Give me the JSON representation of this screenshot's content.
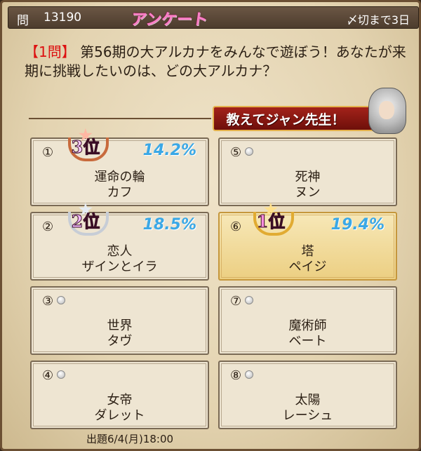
{
  "header": {
    "q_prefix": "問",
    "q_number": "13190",
    "title": "アンケート",
    "deadline": "〆切まで3日"
  },
  "question": {
    "tag": "【1問】",
    "text": "第56期の大アルカナをみんなで遊ぼう！あなたが来期に挑戦したいのは、どの大アルカナ？"
  },
  "ask_button": {
    "label": "教えてジャン先生！"
  },
  "options": [
    {
      "num": "①",
      "name": "運命の輪",
      "sub": "カフ",
      "pct": "14.2%",
      "rank": "3位"
    },
    {
      "num": "⑤",
      "name": "死神",
      "sub": "ヌン",
      "pct": "",
      "rank": ""
    },
    {
      "num": "②",
      "name": "恋人",
      "sub": "ザインとイラ",
      "pct": "18.5%",
      "rank": "2位"
    },
    {
      "num": "⑥",
      "name": "塔",
      "sub": "ペイジ",
      "pct": "19.4%",
      "rank": "1位"
    },
    {
      "num": "③",
      "name": "世界",
      "sub": "タヴ",
      "pct": "",
      "rank": ""
    },
    {
      "num": "⑦",
      "name": "魔術師",
      "sub": "ベート",
      "pct": "",
      "rank": ""
    },
    {
      "num": "④",
      "name": "女帝",
      "sub": "ダレット",
      "pct": "",
      "rank": ""
    },
    {
      "num": "⑧",
      "name": "太陽",
      "sub": "レーシュ",
      "pct": "",
      "rank": ""
    }
  ],
  "footer": {
    "issued": "出題6/4(月)18:00"
  },
  "colors": {
    "percent": "#3ba8e6",
    "title_pink": "#ff7fc8",
    "question_tag": "#dd1111",
    "winner_gold": "#eccf82"
  }
}
